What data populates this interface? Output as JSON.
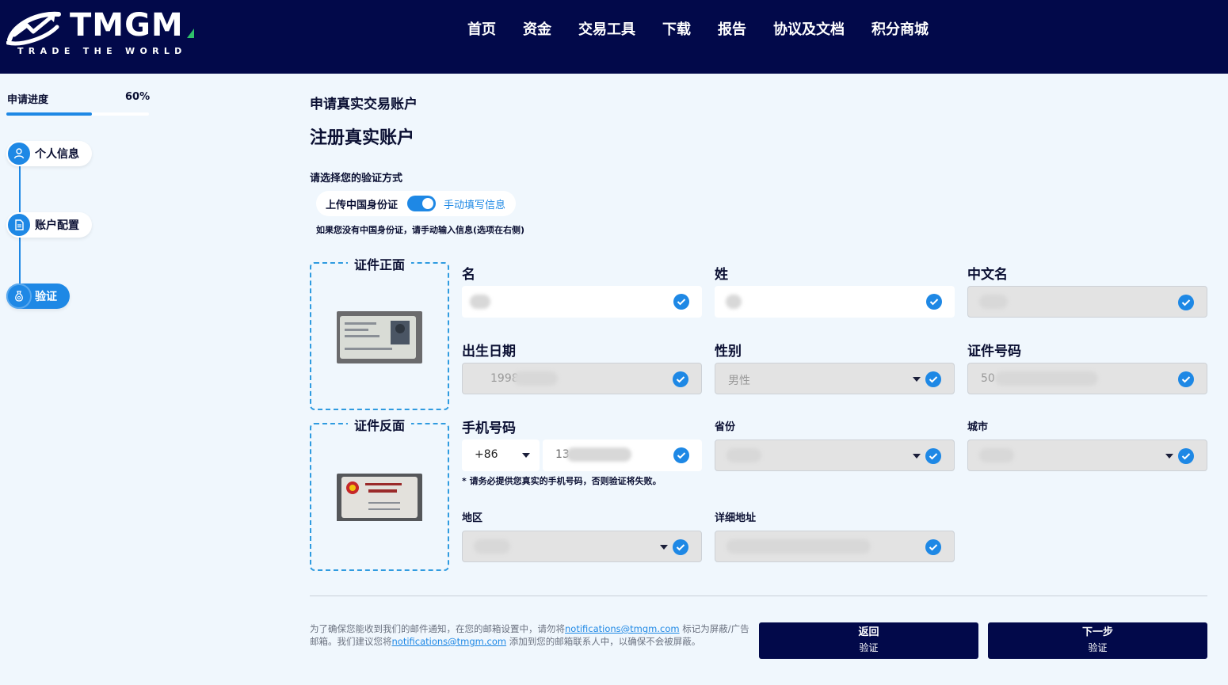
{
  "brand": {
    "name": "TMGM",
    "tagline": "TRADE THE WORLD"
  },
  "nav": [
    "首页",
    "资金",
    "交易工具",
    "下载",
    "报告",
    "协议及文档",
    "积分商城"
  ],
  "progress": {
    "label": "申请进度",
    "value_text": "60%",
    "fraction": 0.6
  },
  "steps": [
    {
      "label": "个人信息",
      "icon": "user-icon",
      "active": false
    },
    {
      "label": "账户配置",
      "icon": "document-icon",
      "active": false
    },
    {
      "label": "验证",
      "icon": "money-bag-icon",
      "active": true
    }
  ],
  "page": {
    "breadcrumb": "申请真实交易账户",
    "title": "注册真实账户"
  },
  "verify": {
    "label": "请选择您的验证方式",
    "option_left": "上传中国身份证",
    "option_right": "手动填写信息",
    "toggle_on": true,
    "hint": "如果您没有中国身份证，请手动输入信息(选项在右侧)"
  },
  "id_uploads": {
    "front_title": "证件正面",
    "back_title": "证件反面"
  },
  "fields": {
    "first_name": {
      "label": "名",
      "value": ""
    },
    "last_name": {
      "label": "姓",
      "value": ""
    },
    "chinese_name": {
      "label": "中文名",
      "value": ""
    },
    "birth_date": {
      "label": "出生日期",
      "value": "1998"
    },
    "gender": {
      "label": "性别",
      "value": "男性"
    },
    "id_number": {
      "label": "证件号码",
      "value": "50"
    },
    "phone": {
      "label": "手机号码",
      "code": "+86",
      "value": "13"
    },
    "province": {
      "label": "省份",
      "value": ""
    },
    "city": {
      "label": "城市",
      "value": ""
    },
    "district": {
      "label": "地区",
      "value": ""
    },
    "address": {
      "label": "详细地址",
      "value": ""
    }
  },
  "phone_note": "* 请务必提供您真实的手机号码，否则验证将失败。",
  "footer": {
    "note_part1": "为了确保您能收到我们的邮件通知，在您的邮箱设置中，请勿将",
    "email": "notifications@tmgm.com",
    "note_part2": " 标记为屏蔽/广告邮箱。我们建议您将",
    "note_part3": " 添加到您的邮箱联系人中，以确保不会被屏蔽。"
  },
  "buttons": {
    "back": {
      "label": "返回",
      "sub": "验证"
    },
    "next": {
      "label": "下一步",
      "sub": "验证"
    }
  },
  "colors": {
    "header_bg": "#02094a",
    "accent": "#1e88e5",
    "page_bg": "#f0f7fd"
  }
}
